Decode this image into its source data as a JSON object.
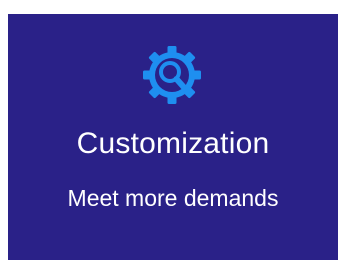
{
  "card": {
    "background": "#2a2188",
    "icon": "gear-search-icon",
    "accent": "#1e8ff0",
    "title": "Customization",
    "subtitle": "Meet more demands"
  }
}
